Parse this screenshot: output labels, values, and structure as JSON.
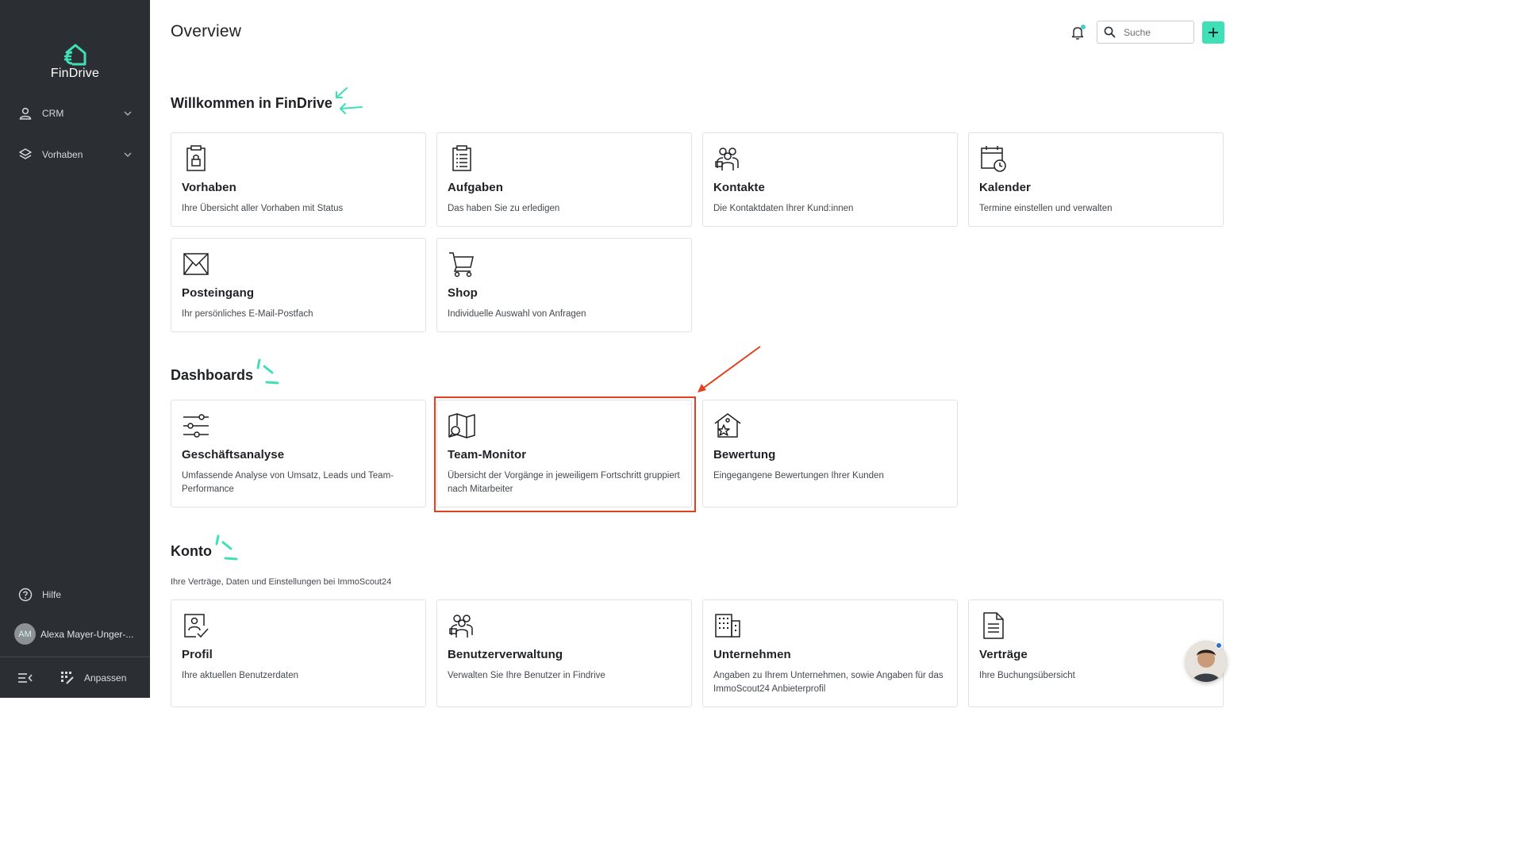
{
  "app": {
    "name": "FinDrive"
  },
  "sidebar": {
    "items": [
      {
        "label": "CRM",
        "icon": "person-icon"
      },
      {
        "label": "Vorhaben",
        "icon": "layers-icon"
      }
    ],
    "help_label": "Hilfe",
    "user": {
      "initials": "AM",
      "name": "Alexa Mayer-Unger-..."
    },
    "customize_label": "Anpassen"
  },
  "header": {
    "title": "Overview",
    "search_placeholder": "Suche"
  },
  "welcome": {
    "title": "Willkommen in FinDrive",
    "cards": [
      {
        "title": "Vorhaben",
        "desc": "Ihre Übersicht aller Vorhaben mit Status",
        "icon": "clipboard-lock-icon"
      },
      {
        "title": "Aufgaben",
        "desc": "Das haben Sie zu erledigen",
        "icon": "checklist-icon"
      },
      {
        "title": "Kontakte",
        "desc": "Die Kontaktdaten Ihrer Kund:innen",
        "icon": "contacts-icon"
      },
      {
        "title": "Kalender",
        "desc": "Termine einstellen und verwalten",
        "icon": "calendar-clock-icon"
      },
      {
        "title": "Posteingang",
        "desc": "Ihr persönliches E-Mail-Postfach",
        "icon": "envelope-icon"
      },
      {
        "title": "Shop",
        "desc": "Individuelle Auswahl von Anfragen",
        "icon": "cart-icon"
      }
    ]
  },
  "dashboards": {
    "title": "Dashboards",
    "cards": [
      {
        "title": "Geschäftsanalyse",
        "desc": "Umfassende Analyse von Umsatz, Leads und Team-Performance",
        "icon": "sliders-icon"
      },
      {
        "title": "Team-Monitor",
        "desc": "Übersicht der Vorgänge in jeweiligem Fortschritt gruppiert nach Mitarbeiter",
        "icon": "map-search-icon"
      },
      {
        "title": "Bewertung",
        "desc": "Eingegangene Bewertungen Ihrer Kunden",
        "icon": "house-star-icon"
      }
    ]
  },
  "konto": {
    "title": "Konto",
    "subtitle": "Ihre Verträge, Daten und Einstellungen bei ImmoScout24",
    "cards": [
      {
        "title": "Profil",
        "desc": "Ihre aktuellen Benutzerdaten",
        "icon": "profile-check-icon"
      },
      {
        "title": "Benutzerverwaltung",
        "desc": "Verwalten Sie Ihre Benutzer in Findrive",
        "icon": "users-icon"
      },
      {
        "title": "Unternehmen",
        "desc": "Angaben zu Ihrem Unternehmen, sowie Angaben für das ImmoScout24 Anbieterprofil",
        "icon": "building-icon"
      },
      {
        "title": "Verträge",
        "desc": "Ihre Buchungsübersicht",
        "icon": "document-icon"
      }
    ]
  },
  "colors": {
    "sidebar": "#2b2f33",
    "accent": "#3fe0b5",
    "highlight": "#e2401f"
  }
}
